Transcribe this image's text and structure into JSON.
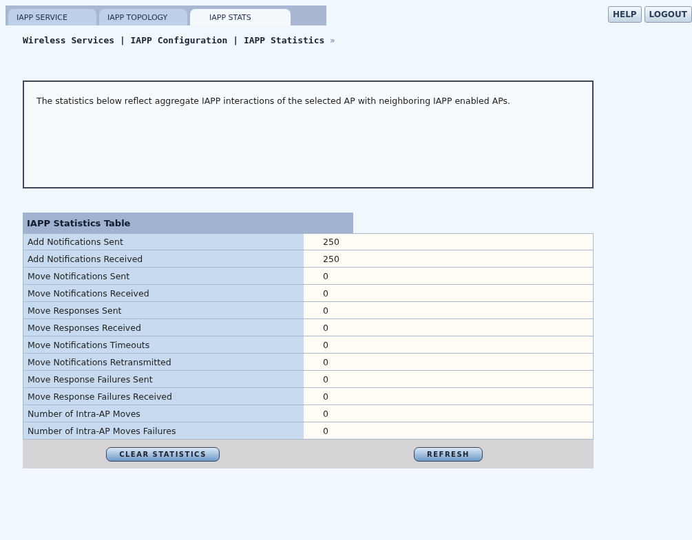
{
  "tabs": [
    {
      "label": "IAPP SERVICE",
      "selected": false
    },
    {
      "label": "IAPP TOPOLOGY",
      "selected": false
    },
    {
      "label": "IAPP STATS",
      "selected": true
    }
  ],
  "header_buttons": [
    "HELP",
    "LOGOUT"
  ],
  "breadcrumb": "Wireless Services | IAPP Configuration | IAPP Statistics",
  "breadcrumb_arrow": "»",
  "description": "The statistics below reflect aggregate IAPP interactions of the selected AP with neighboring IAPP enabled APs.",
  "table": {
    "title": "IAPP Statistics Table",
    "rows": [
      {
        "label": "Add Notifications Sent",
        "value": "250"
      },
      {
        "label": "Add Notifications Received",
        "value": "250"
      },
      {
        "label": "Move Notifications Sent",
        "value": "0"
      },
      {
        "label": "Move Notifications Received",
        "value": "0"
      },
      {
        "label": "Move Responses Sent",
        "value": "0"
      },
      {
        "label": "Move Responses Received",
        "value": "0"
      },
      {
        "label": "Move Notifications Timeouts",
        "value": "0"
      },
      {
        "label": "Move Notifications Retransmitted",
        "value": "0"
      },
      {
        "label": "Move Response Failures Sent",
        "value": "0"
      },
      {
        "label": "Move Response Failures Received",
        "value": "0"
      },
      {
        "label": "Number of Intra-AP Moves",
        "value": "0"
      },
      {
        "label": "Number of Intra-AP Moves Failures",
        "value": "0"
      }
    ]
  },
  "buttons": [
    "CLEAR STATISTICS",
    "REFRESH"
  ]
}
